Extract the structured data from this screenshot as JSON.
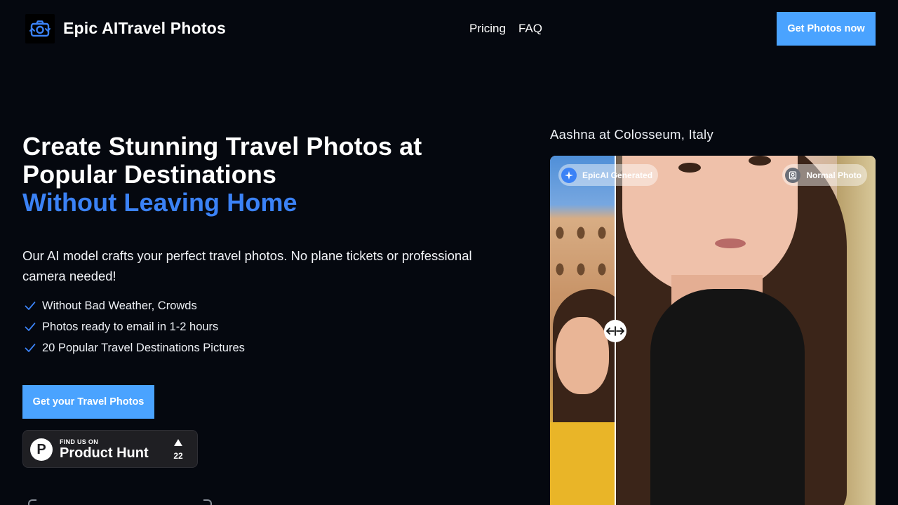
{
  "header": {
    "brand": "Epic AITravel Photos",
    "nav": [
      {
        "label": "Pricing"
      },
      {
        "label": "FAQ"
      }
    ],
    "cta_label": "Get Photos now"
  },
  "hero": {
    "headline_line1": "Create Stunning Travel Photos at",
    "headline_line2": "Popular Destinations",
    "headline_accent": "Without Leaving Home",
    "subtext": "Our AI model crafts your perfect travel photos. No plane tickets or professional camera needed!",
    "features": [
      "Without Bad Weather, Crowds",
      "Photos ready to email in 1-2 hours",
      "20 Popular Travel Destinations Pictures"
    ],
    "cta_label": "Get your Travel Photos",
    "product_hunt": {
      "small_text": "FIND US ON",
      "name": "Product Hunt",
      "upvotes": "22"
    }
  },
  "comparison": {
    "caption": "Aashna at Colosseum, Italy",
    "left_label": "EpicAI Generated",
    "right_label": "Normal Photo",
    "slider_position": 0.2
  },
  "colors": {
    "background": "#05080f",
    "accent_text": "#3b82f6",
    "button": "#4aa3ff"
  },
  "icons": {
    "logo": "camera-refresh-icon",
    "check": "check-icon",
    "slider": "left-right-arrows-icon",
    "generated": "sparkle-icon",
    "normal": "portrait-icon"
  }
}
